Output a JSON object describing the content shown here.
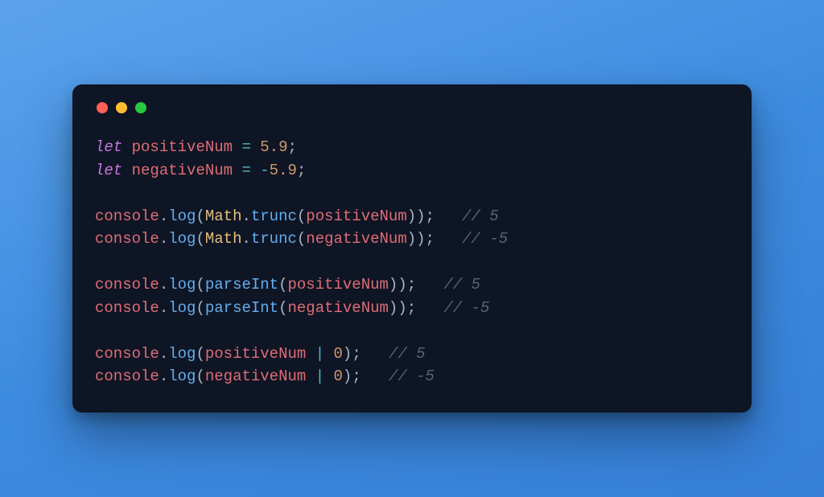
{
  "window": {
    "dots": [
      "red",
      "yellow",
      "green"
    ]
  },
  "code": {
    "tokens": {
      "let": "let",
      "positiveNum": "positiveNum",
      "negativeNum": "negativeNum",
      "eq": "=",
      "minus": "-",
      "n5_9": "5.9",
      "n0": "0",
      "semi": ";",
      "dot": ".",
      "lp": "(",
      "rp": ")",
      "pipe": "|",
      "console": "console",
      "log": "log",
      "Math": "Math",
      "trunc": "trunc",
      "parseInt": "parseInt",
      "sp": " ",
      "sp3": "   ",
      "sp4": "    ",
      "c5": "// 5",
      "cNeg5": "// -5"
    }
  }
}
